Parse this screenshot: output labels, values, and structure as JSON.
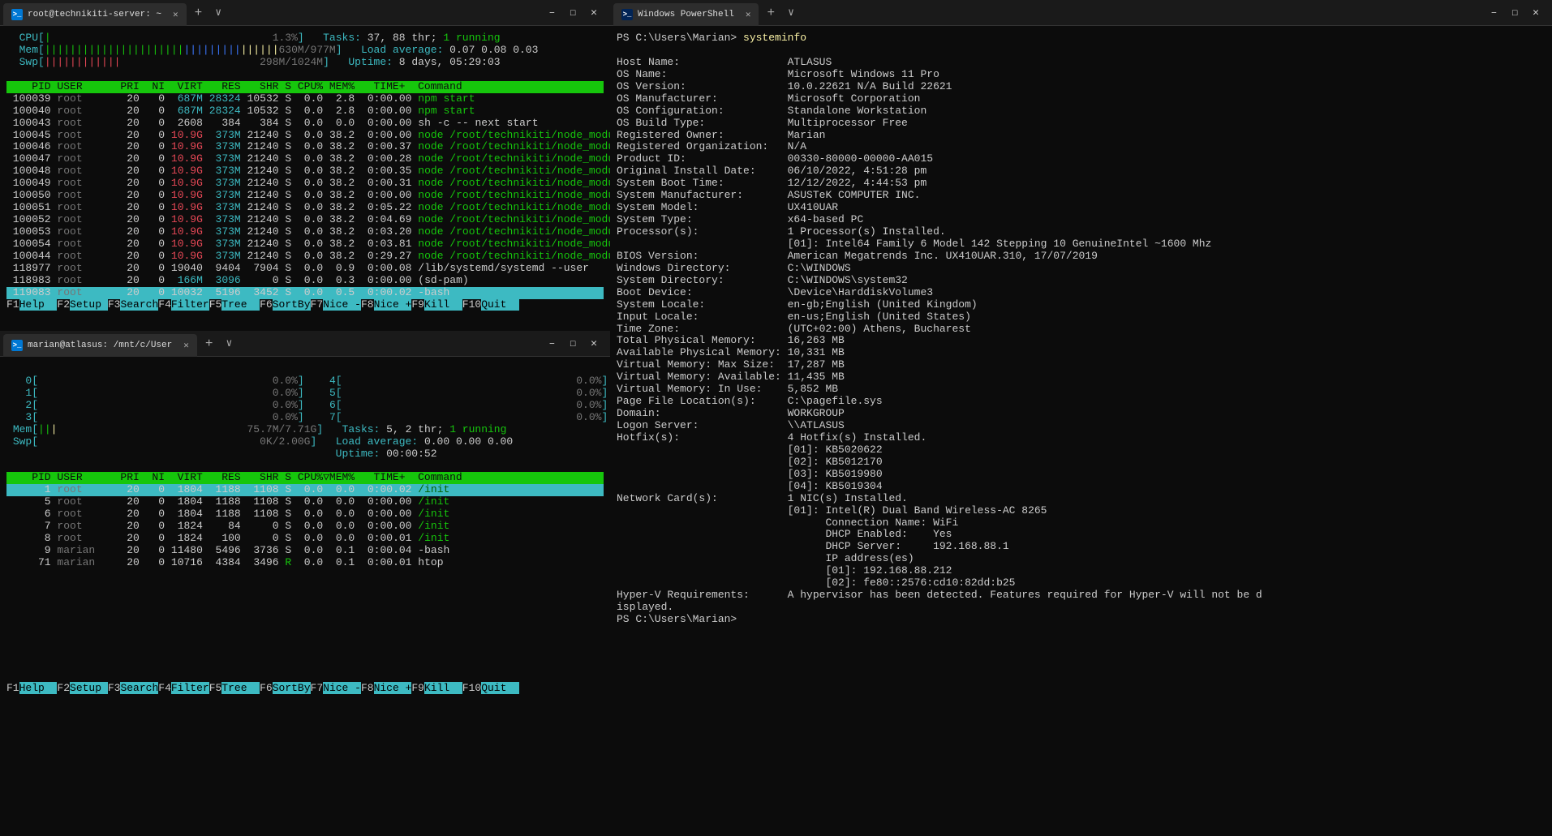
{
  "windows": {
    "topLeft": {
      "tabTitle": "root@technikiti-server: ~",
      "minLabel": "–",
      "maxLabel": "□",
      "closeLabel": "✕",
      "newTab": "+",
      "chev": "∨"
    },
    "bottomLeft": {
      "tabTitle": "marian@atlasus: /mnt/c/User"
    },
    "right": {
      "tabTitle": "Windows PowerShell"
    }
  },
  "htop1": {
    "cpu": {
      "label": "CPU",
      "bar": "|",
      "pct": "1.3%"
    },
    "mem": {
      "label": "Mem",
      "bar": "|||||||||||||||||||||||||||||||||||||",
      "used": "630M",
      "total": "977M"
    },
    "swp": {
      "label": "Swp",
      "bar": "||||||||||||",
      "used": "298M",
      "total": "1024M"
    },
    "tasks": "Tasks: 37, 88 thr; 1 running",
    "load": "Load average: 0.07 0.08 0.03",
    "uptime": "Uptime: 8 days, 05:29:03",
    "header": "    PID USER      PRI  NI  VIRT   RES   SHR S CPU% MEM%   TIME+  Command",
    "rows": [
      {
        "pid": "100039",
        "user": "root",
        "pri": "20",
        "ni": "0",
        "virt": "687M",
        "res": "28324",
        "shr": "10532",
        "s": "S",
        "cpu": "0.0",
        "mem": "2.8",
        "time": "0:00.00",
        "cmd": "npm start",
        "vcol": "cyan"
      },
      {
        "pid": "100040",
        "user": "root",
        "pri": "20",
        "ni": "0",
        "virt": "687M",
        "res": "28324",
        "shr": "10532",
        "s": "S",
        "cpu": "0.0",
        "mem": "2.8",
        "time": "0:00.00",
        "cmd": "npm start",
        "vcol": "cyan"
      },
      {
        "pid": "100043",
        "user": "root",
        "pri": "20",
        "ni": "0",
        "virt": "2608",
        "res": "384",
        "shr": "384",
        "s": "S",
        "cpu": "0.0",
        "mem": "0.0",
        "time": "0:00.00",
        "cmd": "sh -c -- next start",
        "vcol": "white",
        "cmdcol": "white"
      },
      {
        "pid": "100045",
        "user": "root",
        "pri": "20",
        "ni": "0",
        "virt": "10.9G",
        "res": "373M",
        "shr": "21240",
        "s": "S",
        "cpu": "0.0",
        "mem": "38.2",
        "time": "0:00.00",
        "cmd": "node /root/technikiti/node_modules/.b",
        "vcol": "red"
      },
      {
        "pid": "100046",
        "user": "root",
        "pri": "20",
        "ni": "0",
        "virt": "10.9G",
        "res": "373M",
        "shr": "21240",
        "s": "S",
        "cpu": "0.0",
        "mem": "38.2",
        "time": "0:00.37",
        "cmd": "node /root/technikiti/node_modules/.b",
        "vcol": "red"
      },
      {
        "pid": "100047",
        "user": "root",
        "pri": "20",
        "ni": "0",
        "virt": "10.9G",
        "res": "373M",
        "shr": "21240",
        "s": "S",
        "cpu": "0.0",
        "mem": "38.2",
        "time": "0:00.28",
        "cmd": "node /root/technikiti/node_modules/.b",
        "vcol": "red"
      },
      {
        "pid": "100048",
        "user": "root",
        "pri": "20",
        "ni": "0",
        "virt": "10.9G",
        "res": "373M",
        "shr": "21240",
        "s": "S",
        "cpu": "0.0",
        "mem": "38.2",
        "time": "0:00.35",
        "cmd": "node /root/technikiti/node_modules/.b",
        "vcol": "red"
      },
      {
        "pid": "100049",
        "user": "root",
        "pri": "20",
        "ni": "0",
        "virt": "10.9G",
        "res": "373M",
        "shr": "21240",
        "s": "S",
        "cpu": "0.0",
        "mem": "38.2",
        "time": "0:00.31",
        "cmd": "node /root/technikiti/node_modules/.b",
        "vcol": "red"
      },
      {
        "pid": "100050",
        "user": "root",
        "pri": "20",
        "ni": "0",
        "virt": "10.9G",
        "res": "373M",
        "shr": "21240",
        "s": "S",
        "cpu": "0.0",
        "mem": "38.2",
        "time": "0:00.00",
        "cmd": "node /root/technikiti/node_modules/.b",
        "vcol": "red"
      },
      {
        "pid": "100051",
        "user": "root",
        "pri": "20",
        "ni": "0",
        "virt": "10.9G",
        "res": "373M",
        "shr": "21240",
        "s": "S",
        "cpu": "0.0",
        "mem": "38.2",
        "time": "0:05.22",
        "cmd": "node /root/technikiti/node_modules/.b",
        "vcol": "red"
      },
      {
        "pid": "100052",
        "user": "root",
        "pri": "20",
        "ni": "0",
        "virt": "10.9G",
        "res": "373M",
        "shr": "21240",
        "s": "S",
        "cpu": "0.0",
        "mem": "38.2",
        "time": "0:04.69",
        "cmd": "node /root/technikiti/node_modules/.b",
        "vcol": "red"
      },
      {
        "pid": "100053",
        "user": "root",
        "pri": "20",
        "ni": "0",
        "virt": "10.9G",
        "res": "373M",
        "shr": "21240",
        "s": "S",
        "cpu": "0.0",
        "mem": "38.2",
        "time": "0:03.20",
        "cmd": "node /root/technikiti/node_modules/.b",
        "vcol": "red"
      },
      {
        "pid": "100054",
        "user": "root",
        "pri": "20",
        "ni": "0",
        "virt": "10.9G",
        "res": "373M",
        "shr": "21240",
        "s": "S",
        "cpu": "0.0",
        "mem": "38.2",
        "time": "0:03.81",
        "cmd": "node /root/technikiti/node_modules/.b",
        "vcol": "red"
      },
      {
        "pid": "100044",
        "user": "root",
        "pri": "20",
        "ni": "0",
        "virt": "10.9G",
        "res": "373M",
        "shr": "21240",
        "s": "S",
        "cpu": "0.0",
        "mem": "38.2",
        "time": "0:29.27",
        "cmd": "node /root/technikiti/node_modules/.b",
        "vcol": "red"
      },
      {
        "pid": "118977",
        "user": "root",
        "pri": "20",
        "ni": "0",
        "virt": "19040",
        "res": "9404",
        "shr": "7904",
        "s": "S",
        "cpu": "0.0",
        "mem": "0.9",
        "time": "0:00.08",
        "cmd": "/lib/systemd/systemd --user",
        "vcol": "white",
        "cmdcol": "white"
      },
      {
        "pid": "118983",
        "user": "root",
        "pri": "20",
        "ni": "0",
        "virt": "166M",
        "res": "3096",
        "shr": "0",
        "s": "S",
        "cpu": "0.0",
        "mem": "0.3",
        "time": "0:00.00",
        "cmd": "(sd-pam)",
        "vcol": "cyan",
        "cmdcol": "white"
      },
      {
        "pid": "119083",
        "user": "root",
        "pri": "20",
        "ni": "0",
        "virt": "10032",
        "res": "5196",
        "shr": "3452",
        "s": "S",
        "cpu": "0.0",
        "mem": "0.5",
        "time": "0:00.02",
        "cmd": "-bash",
        "vcol": "white",
        "sel": true,
        "cmdcol": "white"
      }
    ],
    "fkeys": [
      {
        "n": "F1",
        "l": "Help  "
      },
      {
        "n": "F2",
        "l": "Setup "
      },
      {
        "n": "F3",
        "l": "Search"
      },
      {
        "n": "F4",
        "l": "Filter"
      },
      {
        "n": "F5",
        "l": "Tree  "
      },
      {
        "n": "F6",
        "l": "SortBy"
      },
      {
        "n": "F7",
        "l": "Nice -"
      },
      {
        "n": "F8",
        "l": "Nice +"
      },
      {
        "n": "F9",
        "l": "Kill  "
      },
      {
        "n": "F10",
        "l": "Quit  "
      }
    ]
  },
  "htop2": {
    "cores": [
      {
        "n": "0",
        "pct": "0.0%"
      },
      {
        "n": "1",
        "pct": "0.0%"
      },
      {
        "n": "2",
        "pct": "0.0%"
      },
      {
        "n": "3",
        "pct": "0.0%"
      },
      {
        "n": "4",
        "pct": "0.0%"
      },
      {
        "n": "5",
        "pct": "0.0%"
      },
      {
        "n": "6",
        "pct": "0.0%"
      },
      {
        "n": "7",
        "pct": "0.0%"
      }
    ],
    "mem": {
      "label": "Mem",
      "bar": "|||",
      "used": "75.7M",
      "total": "7.71G"
    },
    "swp": {
      "label": "Swp",
      "used": "0K",
      "total": "2.00G"
    },
    "tasks": "Tasks: 5, 2 thr; 1 running",
    "load": "Load average: 0.00 0.00 0.00",
    "uptime": "Uptime: 00:00:52",
    "header": "    PID USER      PRI  NI  VIRT   RES   SHR S CPU%▽MEM%   TIME+  Command",
    "rows": [
      {
        "pid": "1",
        "user": "root",
        "pri": "20",
        "ni": "0",
        "virt": "1804",
        "res": "1188",
        "shr": "1108",
        "s": "S",
        "cpu": "0.0",
        "mem": "0.0",
        "time": "0:00.02",
        "cmd": "/init",
        "sel": true
      },
      {
        "pid": "5",
        "user": "root",
        "pri": "20",
        "ni": "0",
        "virt": "1804",
        "res": "1188",
        "shr": "1108",
        "s": "S",
        "cpu": "0.0",
        "mem": "0.0",
        "time": "0:00.00",
        "cmd": "/init"
      },
      {
        "pid": "6",
        "user": "root",
        "pri": "20",
        "ni": "0",
        "virt": "1804",
        "res": "1188",
        "shr": "1108",
        "s": "S",
        "cpu": "0.0",
        "mem": "0.0",
        "time": "0:00.00",
        "cmd": "/init"
      },
      {
        "pid": "7",
        "user": "root",
        "pri": "20",
        "ni": "0",
        "virt": "1824",
        "res": "84",
        "shr": "0",
        "s": "S",
        "cpu": "0.0",
        "mem": "0.0",
        "time": "0:00.00",
        "cmd": "/init"
      },
      {
        "pid": "8",
        "user": "root",
        "pri": "20",
        "ni": "0",
        "virt": "1824",
        "res": "100",
        "shr": "0",
        "s": "S",
        "cpu": "0.0",
        "mem": "0.0",
        "time": "0:00.01",
        "cmd": "/init"
      },
      {
        "pid": "9",
        "user": "marian",
        "pri": "20",
        "ni": "0",
        "virt": "11480",
        "res": "5496",
        "shr": "3736",
        "s": "S",
        "cpu": "0.0",
        "mem": "0.1",
        "time": "0:00.04",
        "cmd": "-bash",
        "cmdcol": "white"
      },
      {
        "pid": "71",
        "user": "marian",
        "pri": "20",
        "ni": "0",
        "virt": "10716",
        "res": "4384",
        "shr": "3496",
        "s": "R",
        "scol": "green",
        "cpu": "0.0",
        "mem": "0.1",
        "time": "0:00.01",
        "cmd": "htop",
        "cmdcol": "white"
      }
    ]
  },
  "powershell": {
    "prompt1": "PS C:\\Users\\Marian> ",
    "cmd": "systeminfo",
    "prompt2": "PS C:\\Users\\Marian>",
    "entries": [
      [
        "Host Name:",
        "ATLASUS"
      ],
      [
        "OS Name:",
        "Microsoft Windows 11 Pro"
      ],
      [
        "OS Version:",
        "10.0.22621 N/A Build 22621"
      ],
      [
        "OS Manufacturer:",
        "Microsoft Corporation"
      ],
      [
        "OS Configuration:",
        "Standalone Workstation"
      ],
      [
        "OS Build Type:",
        "Multiprocessor Free"
      ],
      [
        "Registered Owner:",
        "Marian"
      ],
      [
        "Registered Organization:",
        "N/A"
      ],
      [
        "Product ID:",
        "00330-80000-00000-AA015"
      ],
      [
        "Original Install Date:",
        "06/10/2022, 4:51:28 pm"
      ],
      [
        "System Boot Time:",
        "12/12/2022, 4:44:53 pm"
      ],
      [
        "System Manufacturer:",
        "ASUSTeK COMPUTER INC."
      ],
      [
        "System Model:",
        "UX410UAR"
      ],
      [
        "System Type:",
        "x64-based PC"
      ],
      [
        "Processor(s):",
        "1 Processor(s) Installed."
      ],
      [
        "",
        "[01]: Intel64 Family 6 Model 142 Stepping 10 GenuineIntel ~1600 Mhz"
      ],
      [
        "BIOS Version:",
        "American Megatrends Inc. UX410UAR.310, 17/07/2019"
      ],
      [
        "Windows Directory:",
        "C:\\WINDOWS"
      ],
      [
        "System Directory:",
        "C:\\WINDOWS\\system32"
      ],
      [
        "Boot Device:",
        "\\Device\\HarddiskVolume3"
      ],
      [
        "System Locale:",
        "en-gb;English (United Kingdom)"
      ],
      [
        "Input Locale:",
        "en-us;English (United States)"
      ],
      [
        "Time Zone:",
        "(UTC+02:00) Athens, Bucharest"
      ],
      [
        "Total Physical Memory:",
        "16,263 MB"
      ],
      [
        "Available Physical Memory:",
        "10,331 MB"
      ],
      [
        "Virtual Memory: Max Size:",
        "17,287 MB"
      ],
      [
        "Virtual Memory: Available:",
        "11,435 MB"
      ],
      [
        "Virtual Memory: In Use:",
        "5,852 MB"
      ],
      [
        "Page File Location(s):",
        "C:\\pagefile.sys"
      ],
      [
        "Domain:",
        "WORKGROUP"
      ],
      [
        "Logon Server:",
        "\\\\ATLASUS"
      ],
      [
        "Hotfix(s):",
        "4 Hotfix(s) Installed."
      ],
      [
        "",
        "[01]: KB5020622"
      ],
      [
        "",
        "[02]: KB5012170"
      ],
      [
        "",
        "[03]: KB5019980"
      ],
      [
        "",
        "[04]: KB5019304"
      ],
      [
        "Network Card(s):",
        "1 NIC(s) Installed."
      ],
      [
        "",
        "[01]: Intel(R) Dual Band Wireless-AC 8265"
      ],
      [
        "",
        "      Connection Name: WiFi"
      ],
      [
        "",
        "      DHCP Enabled:    Yes"
      ],
      [
        "",
        "      DHCP Server:     192.168.88.1"
      ],
      [
        "",
        "      IP address(es)"
      ],
      [
        "",
        "      [01]: 192.168.88.212"
      ],
      [
        "",
        "      [02]: fe80::2576:cd10:82dd:b25"
      ],
      [
        "Hyper-V Requirements:",
        "A hypervisor has been detected. Features required for Hyper-V will not be d"
      ],
      [
        "isplayed.",
        ""
      ]
    ]
  }
}
